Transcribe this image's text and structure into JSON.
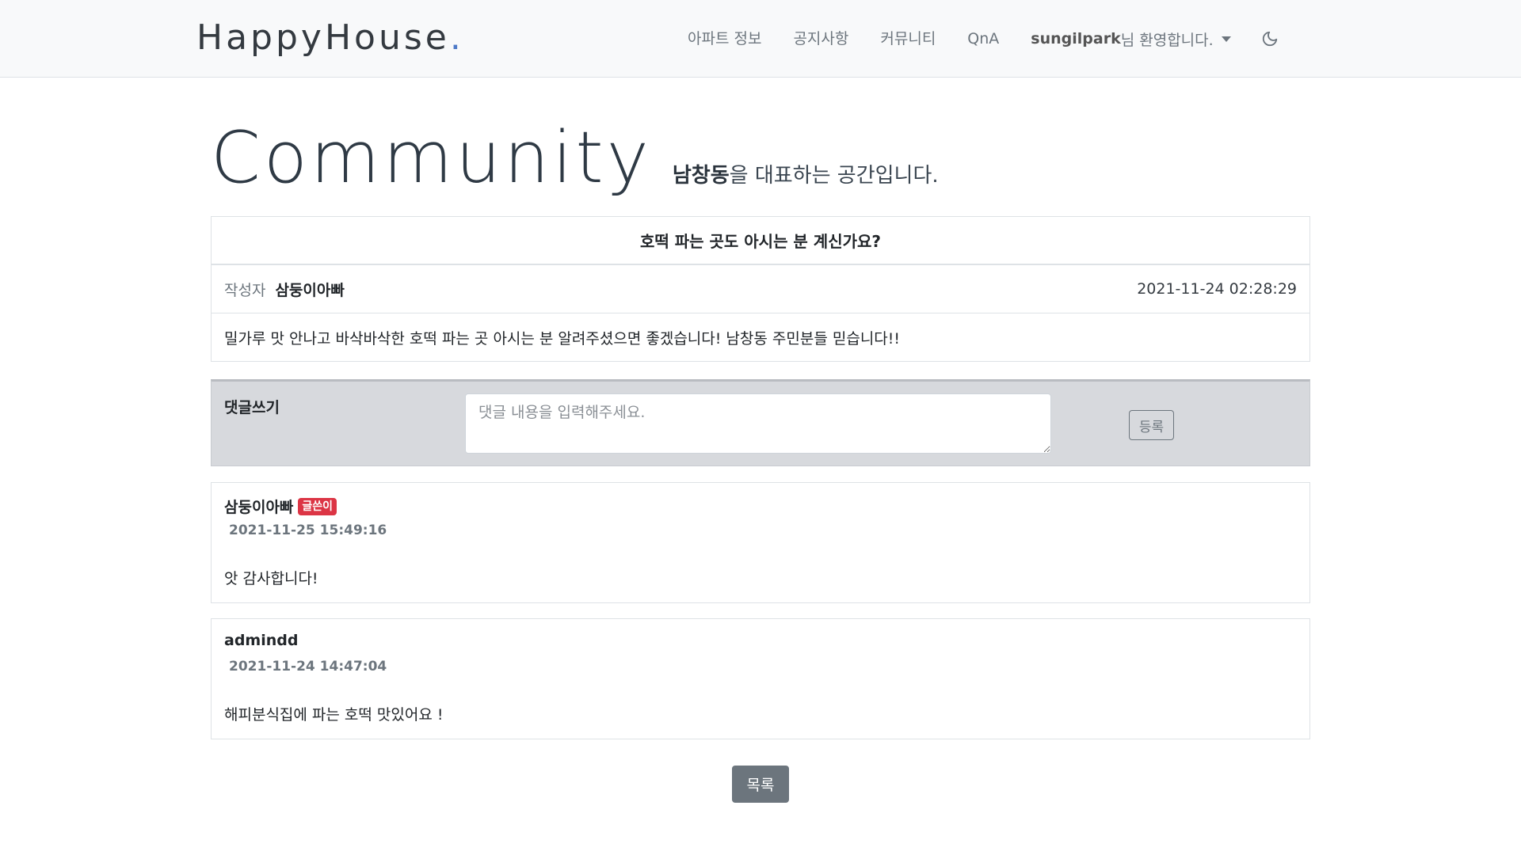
{
  "nav": {
    "brand": "HappyHouse",
    "brand_dot": ".",
    "items": [
      "아파트 정보",
      "공지사항",
      "커뮤니티",
      "QnA"
    ],
    "username": "sungilpark",
    "welcome_suffix": "님 환영합니다."
  },
  "header": {
    "title": "Community",
    "subtitle_bold": "남창동",
    "subtitle_rest": "을 대표하는 공간입니다."
  },
  "post": {
    "title": "호떡 파는 곳도 아시는 분 계신가요?",
    "author_label": "작성자",
    "author": "삼둥이아빠",
    "date": "2021-11-24 02:28:29",
    "content": "밀가루 맛 안나고 바삭바삭한 호떡 파는 곳 아시는 분 알려주셨으면 좋겠습니다! 남창동 주민분들 믿습니다!!"
  },
  "comment_form": {
    "label": "댓글쓰기",
    "placeholder": "댓글 내용을 입력해주세요.",
    "submit_label": "등록"
  },
  "comments": [
    {
      "author": "삼둥이아빠",
      "badge": "글쓴이",
      "date": "2021-11-25 15:49:16",
      "text": "앗 감사합니다!"
    },
    {
      "author": "admindd",
      "badge": "",
      "date": "2021-11-24 14:47:04",
      "text": "해피분식집에 파는 호떡 맛있어요 !"
    }
  ],
  "list_button": "목록",
  "colors": {
    "accent_dot": "#4e7ac7",
    "badge": "#dc3545",
    "secondary": "#6c757d"
  }
}
